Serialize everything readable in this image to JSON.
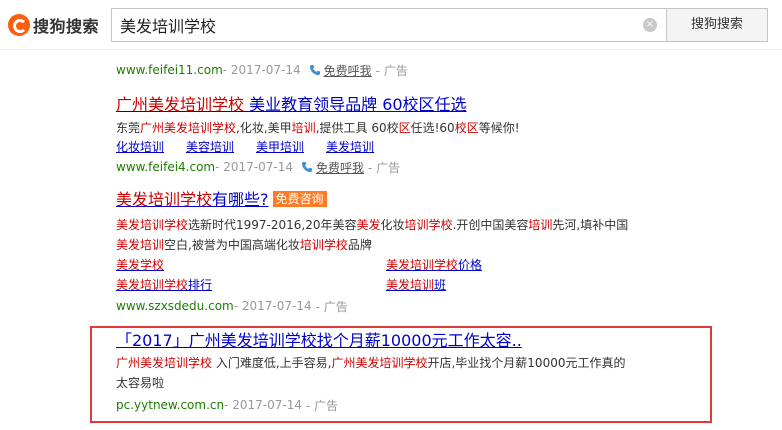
{
  "brand": {
    "logo_text": "搜狗搜索"
  },
  "search": {
    "query": "美发培训学校",
    "button_label": "搜狗搜索",
    "clear_glyph": "×"
  },
  "colors": {
    "accent": "#fe5e0c",
    "link": "#0000cc",
    "url_green": "#1e7d00",
    "keyword_red": "#cc0000",
    "highlight_border": "#e03a3a",
    "badge_orange": "#ff7c26"
  },
  "results": [
    {
      "url": "www.feifei11.com",
      "date": " - 2017-07-14 ",
      "call_label": "免费呼我",
      "ad_label": " - 广告"
    },
    {
      "title_pre": "广州美发培训学校",
      "title_post": " 美业教育领导品牌 60校区任选",
      "desc": "东莞广州美发培训学校,化妆,美甲培训,提供工具 60校区任选!60校区等候你!",
      "sublinks": [
        "化妆培训",
        "美容培训",
        "美甲培训",
        "美发培训"
      ],
      "url": "www.feifei4.com",
      "date": " - 2017-07-14 ",
      "call_label": "免费呼我",
      "ad_label": " - 广告"
    },
    {
      "title_pre": "美发培训学校",
      "title_post": "有哪些?",
      "badge": "免费咨询",
      "desc_line1": "美发培训学校选新时代1997-2016,20年美容美发化妆培训学校.开创中国美容培训先河,填补中国",
      "desc_line2": "美发培训空白,被誉为中国高端化妆培训学校品牌",
      "sublinks": [
        "美发学校",
        "美发培训学校价格",
        "美发培训学校排行",
        "美发培训班"
      ],
      "url": "www.szxsdedu.com",
      "date": " - 2017-07-14 ",
      "ad_label": " - 广告"
    },
    {
      "title": "「2017」广州美发培训学校找个月薪10000元工作太容..",
      "desc_line1": "广州美发培训学校 入门难度低,上手容易,广州美发培训学校开店,毕业找个月薪10000元工作真的",
      "desc_line2": "太容易啦",
      "url": "pc.yytnew.com.cn",
      "date": " - 2017-07-14 ",
      "ad_label": " - 广告"
    }
  ]
}
